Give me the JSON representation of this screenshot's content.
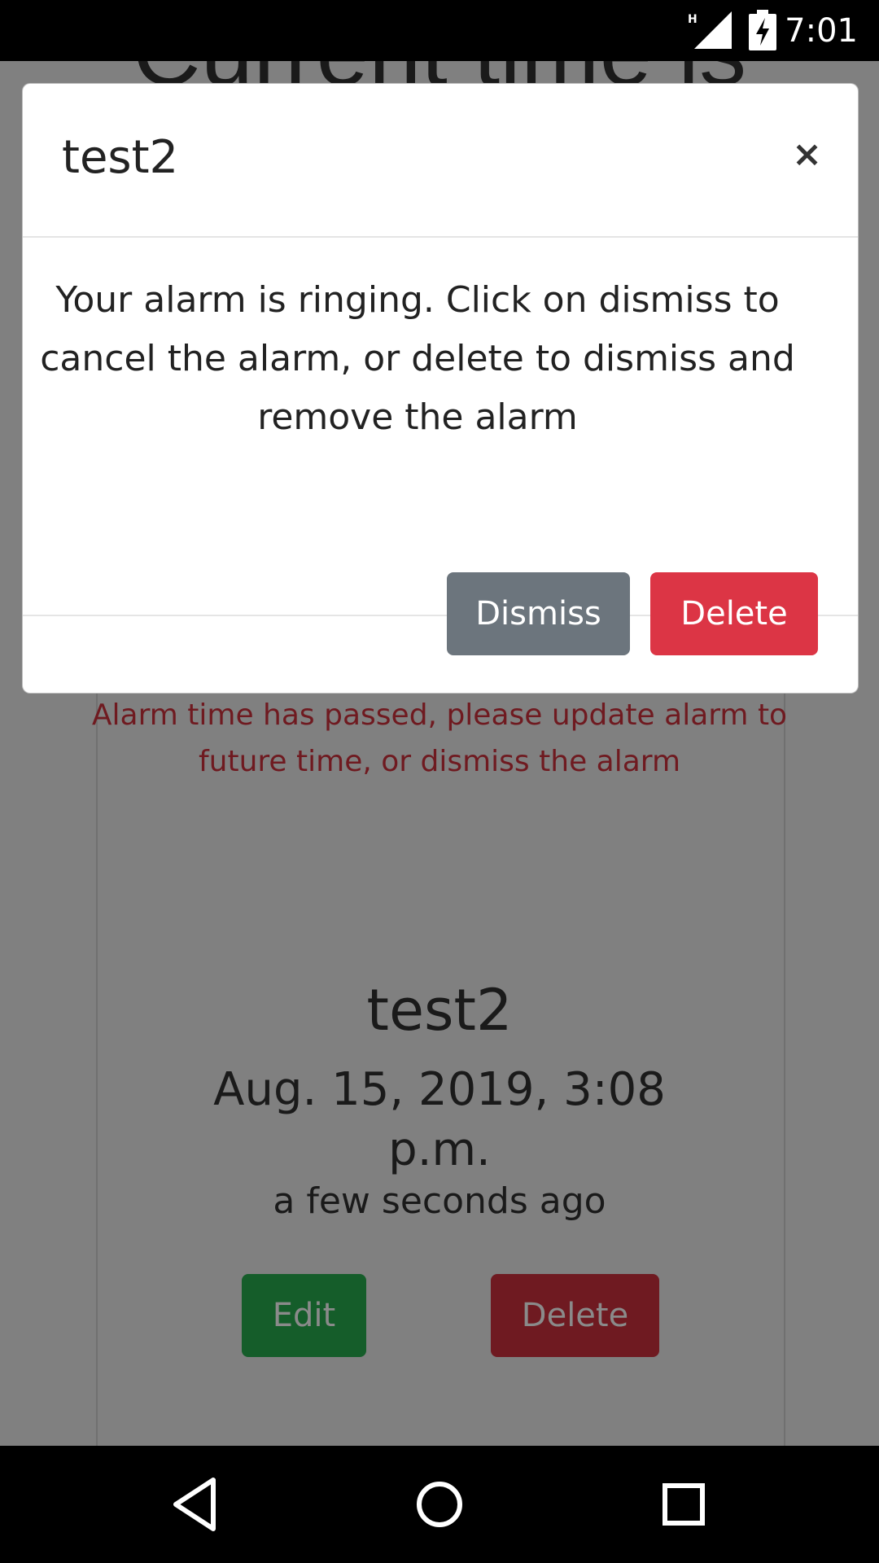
{
  "status_bar": {
    "time": "7:01",
    "network_label": "H"
  },
  "page": {
    "heading": "Current time is",
    "alarm_warning": "Alarm time has passed, please update alarm to future time, or dismiss the alarm",
    "alarm_name": "test2",
    "alarm_datetime": "Aug. 15, 2019, 3:08 p.m.",
    "alarm_relative": "a few seconds ago",
    "edit_label": "Edit",
    "delete_label": "Delete"
  },
  "modal": {
    "title": "test2",
    "close_symbol": "×",
    "message": "Your alarm is ringing. Click on dismiss to cancel the alarm, or delete to dismiss and remove the alarm",
    "dismiss_label": "Dismiss",
    "delete_label": "Delete"
  },
  "colors": {
    "backdrop": "#808080",
    "dismiss_button": "#6c757d",
    "delete_button": "#dc3545",
    "edit_button_dimmed": "#155d2a",
    "delete_button_dimmed": "#6f1a21",
    "warning_text_dimmed": "#6f1a20"
  },
  "nav_bar": {
    "icons": [
      "back-icon",
      "home-icon",
      "recents-icon"
    ]
  }
}
